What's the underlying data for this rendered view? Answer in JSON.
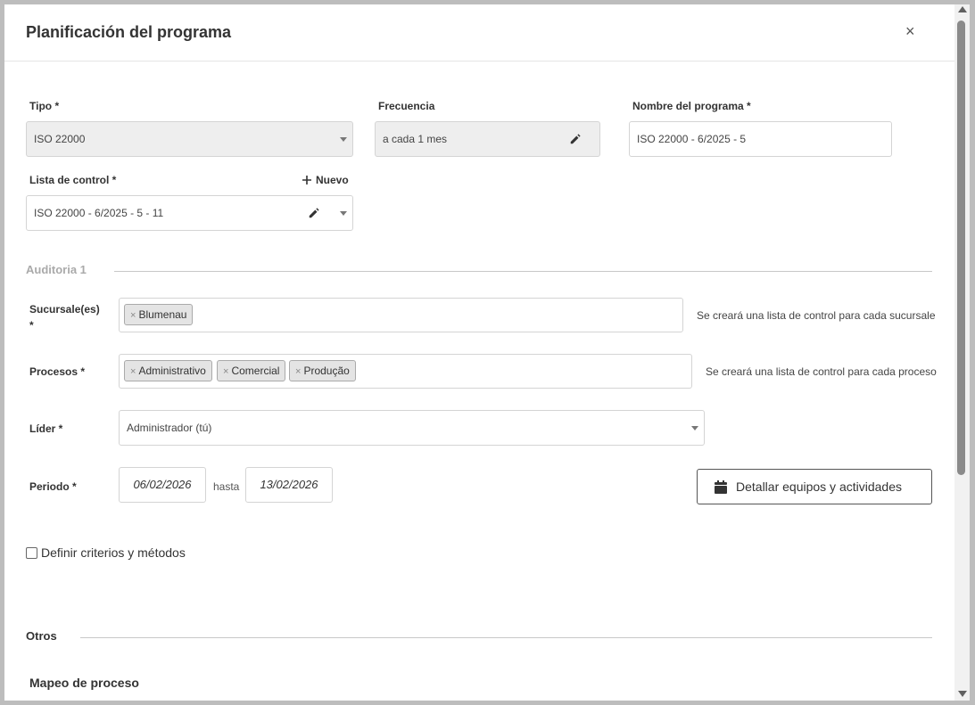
{
  "modal": {
    "title": "Planificación del programa",
    "close_label": "×"
  },
  "form": {
    "tipo": {
      "label": "Tipo *",
      "value": "ISO 22000"
    },
    "frecuencia": {
      "label": "Frecuencia",
      "value": "a cada 1 mes"
    },
    "nombre": {
      "label": "Nombre del programa *",
      "value": "ISO 22000 - 6/2025 - 5"
    },
    "lista": {
      "label": "Lista de control *",
      "new_label": "Nuevo",
      "value": "ISO 22000 - 6/2025 - 5 - 11"
    }
  },
  "auditoria": {
    "title": "Auditoria 1",
    "sucursales": {
      "label_line1": "Sucursale(es)",
      "label_line2": "*",
      "tags": [
        "Blumenau"
      ],
      "hint": "Se creará una lista de control para cada sucursale"
    },
    "procesos": {
      "label": "Procesos *",
      "tags": [
        "Administrativo",
        "Comercial",
        "Produção"
      ],
      "hint": "Se creará una lista de control para cada proceso"
    },
    "lider": {
      "label": "Líder *",
      "value": "Administrador (tú)"
    },
    "periodo": {
      "label": "Periodo *",
      "start": "06/02/2026",
      "separator": "hasta",
      "end": "13/02/2026"
    },
    "detail_button": "Detallar equipos y actividades",
    "criteria_checkbox": "Definir criterios y métodos"
  },
  "otros": {
    "title": "Otros",
    "mapeo_title": "Mapeo de proceso"
  },
  "colors": {
    "backdrop": "#bdbdbd",
    "field_gray": "#eeeeee",
    "section_muted": "#aaaaaa"
  },
  "icons": {
    "close": "close-icon",
    "pencil": "pencil-icon",
    "plus": "plus-icon",
    "calendar": "calendar-icon",
    "remove": "remove-tag-icon",
    "caret": "chevron-down-icon"
  }
}
